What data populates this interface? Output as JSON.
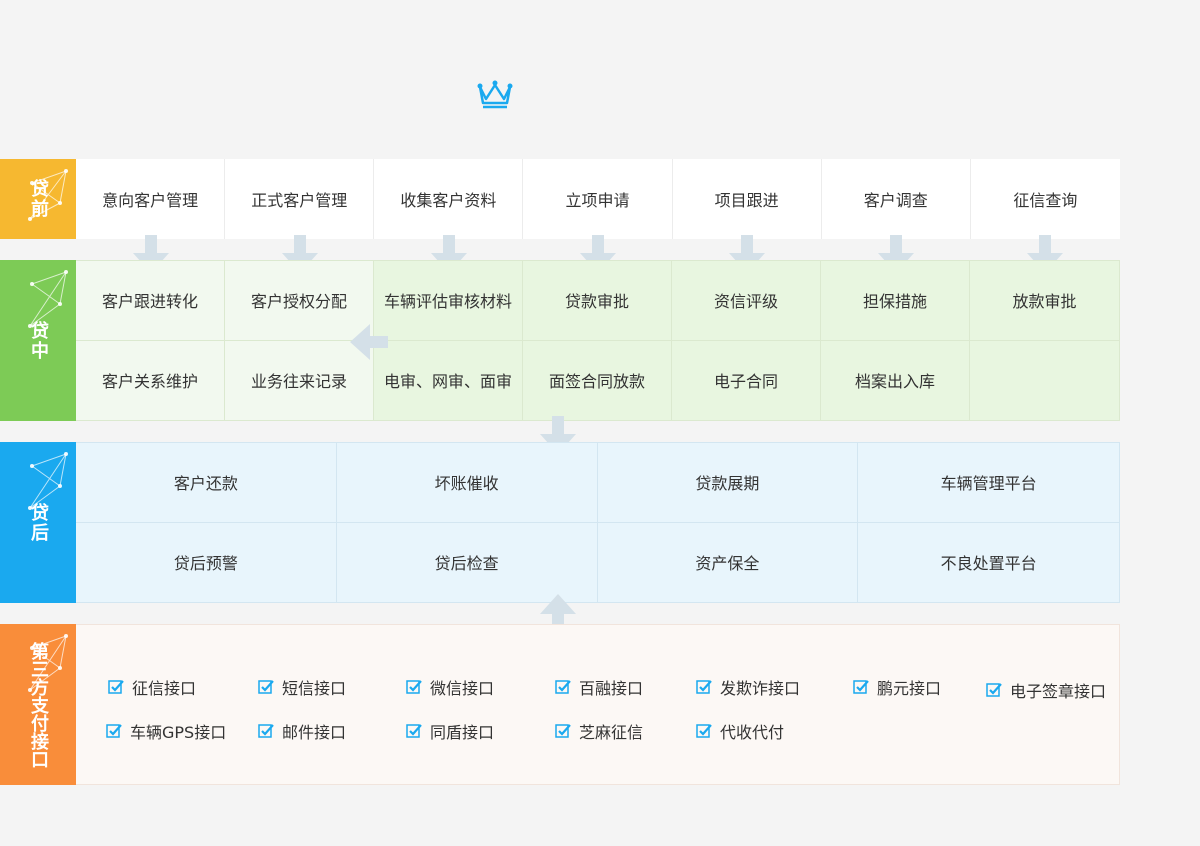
{
  "colors": {
    "pre": "#f6b830",
    "mid": "#7dcb56",
    "post": "#1aa9ef",
    "third": "#f98d3a",
    "arrow": "#d4e0e8",
    "crown": "#1aa9ef",
    "check": "#1aa9ef"
  },
  "pre": {
    "label": "贷前",
    "items": [
      "意向客户管理",
      "正式客户管理",
      "收集客户资料",
      "立项申请",
      "项目跟进",
      "客户调查",
      "征信查询"
    ]
  },
  "mid": {
    "label": "贷中",
    "row1": [
      "客户跟进转化",
      "客户授权分配",
      "车辆评估审核材料",
      "贷款审批",
      "资信评级",
      "担保措施",
      "放款审批"
    ],
    "row2": [
      "客户关系维护",
      "业务往来记录",
      "电审、网审、面审",
      "面签合同放款",
      "电子合同",
      "档案出入库",
      ""
    ]
  },
  "post": {
    "label": "贷后",
    "row1": [
      "客户还款",
      "坏账催收",
      "贷款展期",
      "车辆管理平台"
    ],
    "row2": [
      "贷后预警",
      "贷后检查",
      "资产保全",
      "不良处置平台"
    ]
  },
  "third": {
    "label": "第三方支付接口",
    "row1": [
      "征信接口",
      "短信接口",
      "微信接口",
      "百融接口",
      "发欺诈接口",
      "鹏元接口",
      "电子签章接口"
    ],
    "row2": [
      "车辆GPS接口",
      "邮件接口",
      "同盾接口",
      "芝麻征信",
      "代收代付"
    ]
  }
}
